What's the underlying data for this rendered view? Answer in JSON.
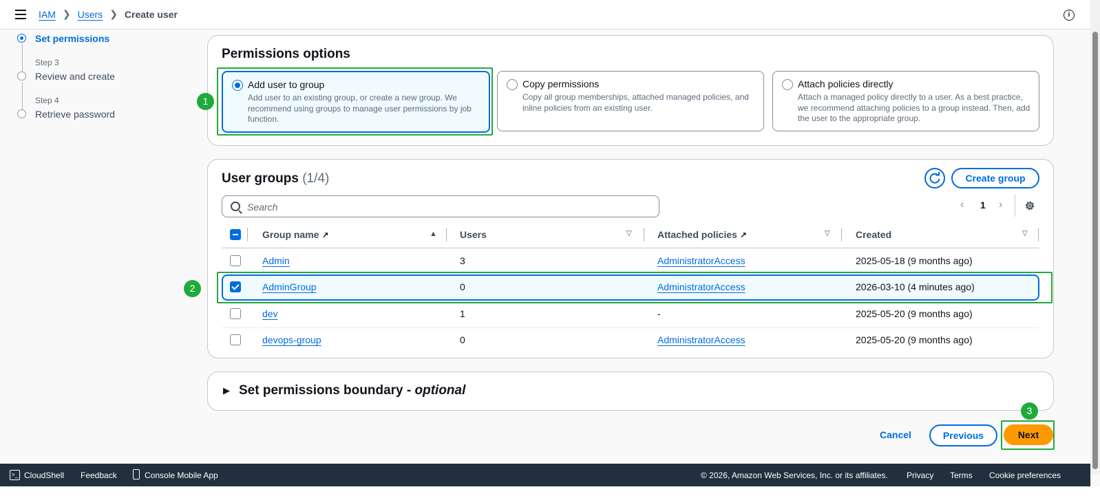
{
  "breadcrumb": {
    "iam": "IAM",
    "users": "Users",
    "current": "Create user"
  },
  "steps": {
    "set_permissions": "Set permissions",
    "step3_small": "Step 3",
    "step3": "Review and create",
    "step4_small": "Step 4",
    "step4": "Retrieve password"
  },
  "permissions": {
    "title": "Permissions options",
    "options": [
      {
        "title": "Add user to group",
        "desc": "Add user to an existing group, or create a new group. We recommend using groups to manage user permissions by job function."
      },
      {
        "title": "Copy permissions",
        "desc": "Copy all group memberships, attached managed policies, and inline policies from an existing user."
      },
      {
        "title": "Attach policies directly",
        "desc": "Attach a managed policy directly to a user. As a best practice, we recommend attaching policies to a group instead. Then, add the user to the appropriate group."
      }
    ]
  },
  "groups": {
    "title": "User groups",
    "count": "(1/4)",
    "create_label": "Create group",
    "search_placeholder": "Search",
    "page": "1",
    "columns": [
      "Group name",
      "Users",
      "Attached policies",
      "Created"
    ],
    "rows": [
      {
        "name": "Admin",
        "users": "3",
        "policy": "AdministratorAccess",
        "created": "2025-05-18 (9 months ago)"
      },
      {
        "name": "AdminGroup",
        "users": "0",
        "policy": "AdministratorAccess",
        "created": "2026-03-10 (4 minutes ago)"
      },
      {
        "name": "dev",
        "users": "1",
        "policy": "-",
        "created": "2025-05-20 (9 months ago)"
      },
      {
        "name": "devops-group",
        "users": "0",
        "policy": "AdministratorAccess",
        "created": "2025-05-20 (9 months ago)"
      }
    ]
  },
  "boundary": {
    "title": "Set permissions boundary - ",
    "optional": "optional"
  },
  "actions": {
    "cancel": "Cancel",
    "previous": "Previous",
    "next": "Next"
  },
  "annotations": [
    "1",
    "2",
    "3"
  ],
  "footer": {
    "cloudshell": "CloudShell",
    "feedback": "Feedback",
    "mobile": "Console Mobile App",
    "copyright": "© 2026, Amazon Web Services, Inc. or its affiliates.",
    "privacy": "Privacy",
    "terms": "Terms",
    "cookies": "Cookie preferences"
  },
  "colors": {
    "accent": "#006ce0",
    "primary_button": "#ff9900",
    "annotation": "#1faa3a",
    "footer_bg": "#232f3e"
  }
}
